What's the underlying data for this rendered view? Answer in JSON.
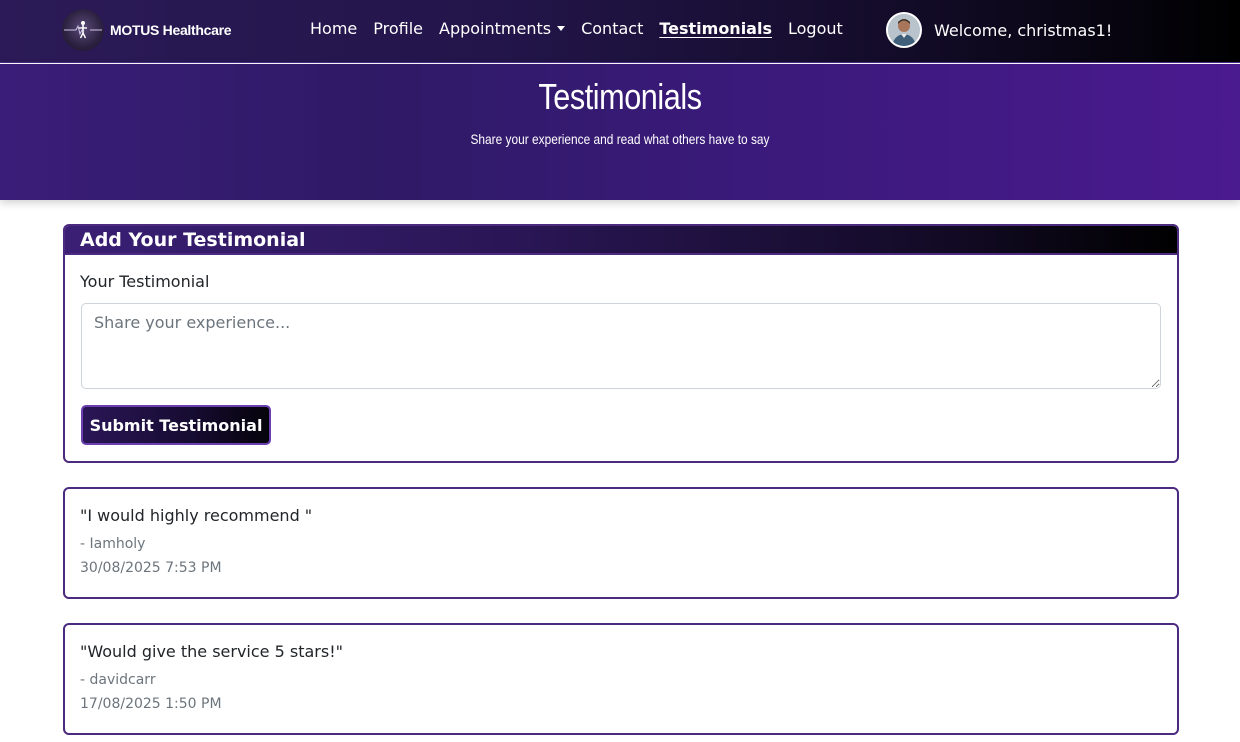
{
  "navbar": {
    "brand_name": "MOTUS Healthcare",
    "links": [
      {
        "label": "Home"
      },
      {
        "label": "Profile"
      },
      {
        "label": "Appointments"
      },
      {
        "label": "Contact"
      },
      {
        "label": "Testimonials",
        "active": true
      },
      {
        "label": "Logout"
      }
    ],
    "welcome_text": "Welcome, christmas1!"
  },
  "hero": {
    "title": "Testimonials",
    "subtitle": "Share your experience and read what others have to say"
  },
  "form": {
    "header": "Add Your Testimonial",
    "label": "Your Testimonial",
    "placeholder": "Share your experience...",
    "value": "",
    "submit_label": "Submit Testimonial"
  },
  "testimonials": [
    {
      "quote": "\"I would highly recommend \"",
      "author": "- Iamholy",
      "date": "30/08/2025 7:53 PM"
    },
    {
      "quote": "\"Would give the service 5 stars!\"",
      "author": "- davidcarr",
      "date": "17/08/2025 1:50 PM"
    }
  ],
  "colors": {
    "accent": "#4b2a7f",
    "hero": "#3a1d78",
    "navbar_dark": "#000000"
  }
}
